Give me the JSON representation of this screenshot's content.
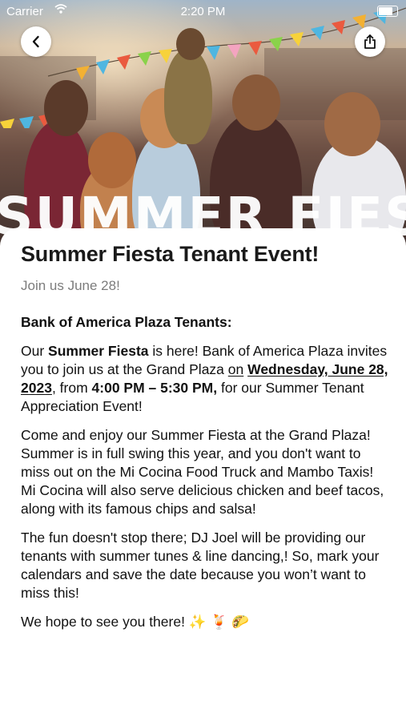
{
  "status_bar": {
    "carrier": "Carrier",
    "time": "2:20 PM",
    "battery_level": 0.85
  },
  "hero": {
    "overlay_title": "SUMMER FIESTA",
    "image": "rooftop-party-photo"
  },
  "nav": {
    "back_icon": "chevron-left-icon",
    "share_icon": "share-icon"
  },
  "event": {
    "title": "Summer Fiesta Tenant Event!",
    "subtitle": "Join us June 28!",
    "greeting": "Bank of America Plaza Tenants:",
    "p1": {
      "t1": "Our ",
      "b1": "Summer Fiesta",
      "t2": " is here! Bank of America Plaza invites you to join us at the Grand Plaza ",
      "u1": "on",
      "u2": "Wednesday, June 28, 2023",
      "t3": ", from ",
      "b2": "4:00 PM – 5:30 PM,",
      "t4": " for our Summer Tenant Appreciation Event!"
    },
    "p2": "Come and enjoy our Summer Fiesta at the Grand Plaza! Summer is in full swing this year, and you don't want to miss out on the Mi Cocina Food Truck and Mambo Taxis! Mi Cocina will also serve delicious chicken and beef tacos, along with its famous chips and salsa!",
    "p3": "The fun doesn't stop there; DJ Joel will be providing our tenants with summer tunes & line dancing,! So, mark your calendars and save the date because you won’t want to miss this!",
    "p4": "We hope to see you there! ✨ 🍹 🌮"
  },
  "colors": {
    "card_bg": "#ffffff",
    "title": "#1a1a1a",
    "subtitle": "#7c7c7c",
    "body": "#111111"
  }
}
